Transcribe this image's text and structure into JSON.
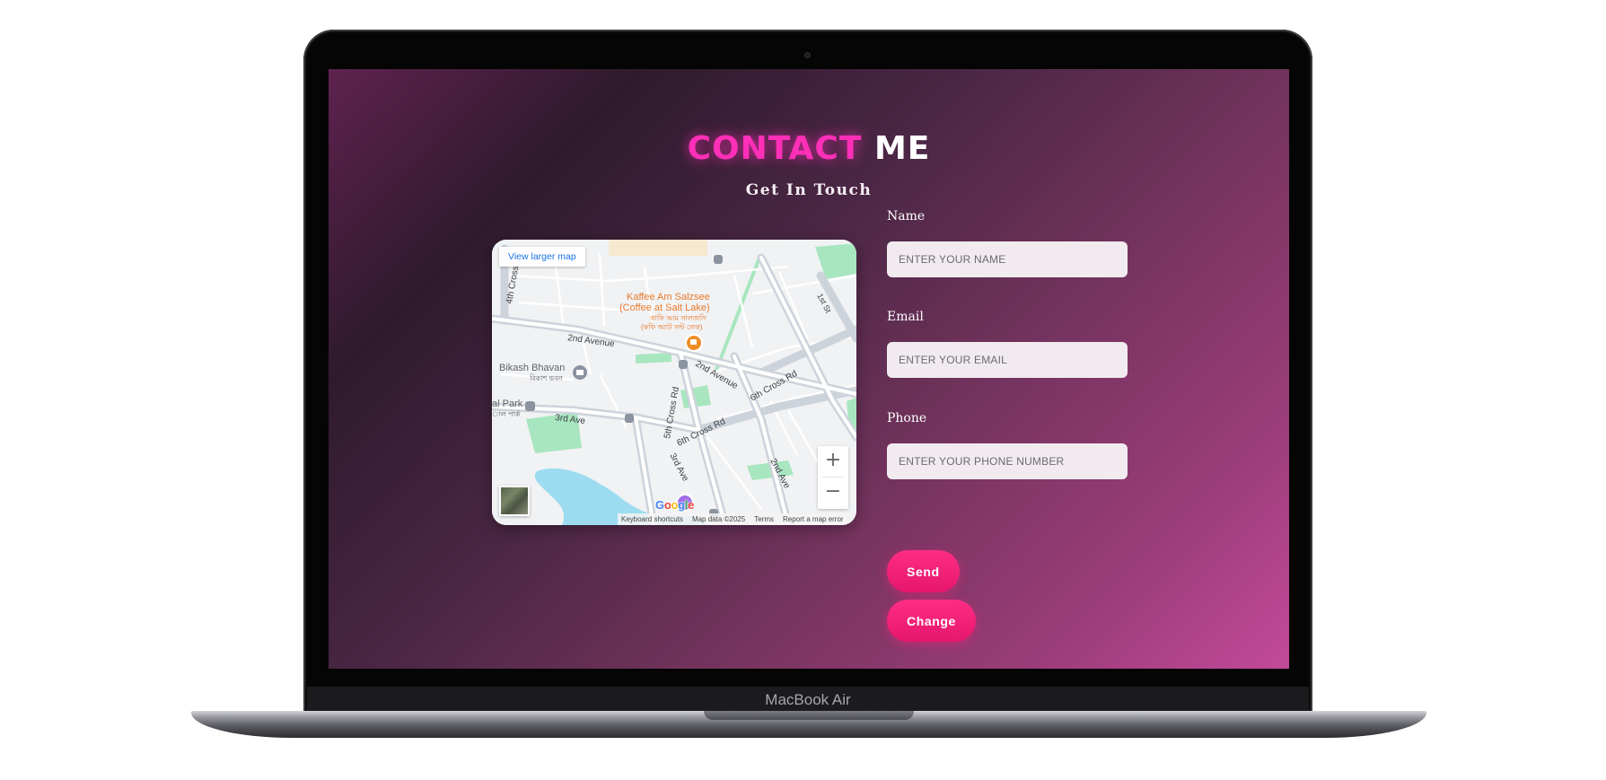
{
  "device": {
    "brand_label": "MacBook Air"
  },
  "page": {
    "title_accent": "CONTACT",
    "title_rest": "ME",
    "subtitle": "Get In Touch"
  },
  "map": {
    "larger_map_link": "View larger map",
    "zoom_in": "+",
    "zoom_out": "−",
    "logo_text": "Google",
    "footer": {
      "shortcuts": "Keyboard shortcuts",
      "map_data": "Map data ©2025",
      "terms": "Terms",
      "report": "Report a map error"
    },
    "places": {
      "cafe_name": "Kaffee Am Salzsee",
      "cafe_name_en": "(Coffee at Salt Lake)",
      "cafe_name_bn_1": "কাফি আম সালজসি",
      "cafe_name_bn_2": "(কফি অ্যাট সল্ট লেক)",
      "building": "Bikash Bhavan",
      "building_bn": "বিকাশ ভবন",
      "park": "al Park",
      "park_bn": "াল পার্ক"
    },
    "roads": {
      "road_2nd_avenue": "2nd Avenue",
      "road_2nd_avenue_b": "2nd Avenue",
      "road_3rd_ave": "3rd Ave",
      "road_3rd_ave_b": "3rd Ave",
      "road_4th_cross": "4th Cross",
      "road_5th_cross": "5th Cross Rd",
      "road_6th_cross_a": "6th Cross Rd",
      "road_6th_cross_b": "6th Cross Rd",
      "road_2nd_ave_c": "2nd Ave",
      "road_1st_st": "1st St"
    },
    "colors": {
      "land": "#f1f2f4",
      "road": "#cdd3db",
      "park": "#a8e6bf",
      "water": "#9ddcf0",
      "poi_orange": "#f08c26"
    }
  },
  "form": {
    "name_label": "Name",
    "name_placeholder": "ENTER YOUR NAME",
    "email_label": "Email",
    "email_placeholder": "ENTER YOUR EMAIL",
    "phone_label": "Phone",
    "phone_placeholder": "ENTER YOUR PHONE NUMBER",
    "send_label": "Send",
    "change_label": "Change"
  },
  "colors": {
    "accent_pink": "#ff2fb8",
    "button_pink": "#ff2d84",
    "bg_gradient_start": "#5e2250",
    "bg_gradient_end": "#c24a99"
  }
}
